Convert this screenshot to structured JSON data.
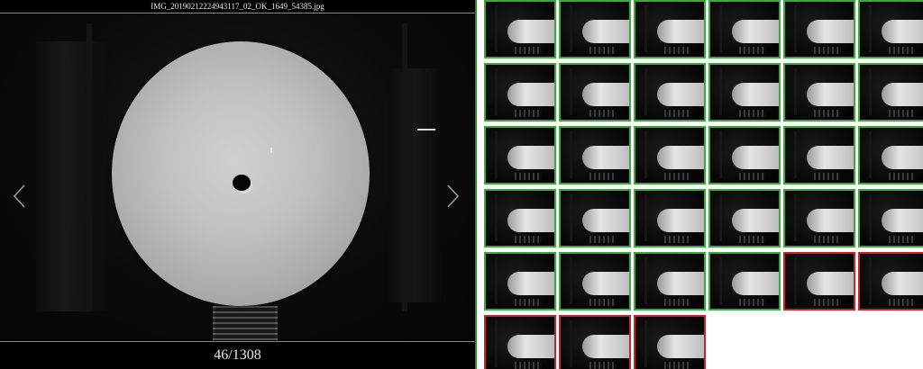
{
  "viewer": {
    "filename": "IMG_20190212224943117_02_OK_1649_54385.jpg",
    "counter": "46/1308"
  },
  "colors": {
    "ok_border": "#3aa83a",
    "ng_border": "#c8232c",
    "viewer_bg": "#000000"
  },
  "icons": {
    "prev": "chevron-left-icon",
    "next": "chevron-right-icon"
  },
  "thumbnails": [
    {
      "status": "ok"
    },
    {
      "status": "ok"
    },
    {
      "status": "ok"
    },
    {
      "status": "ok"
    },
    {
      "status": "ok"
    },
    {
      "status": "ok"
    },
    {
      "status": "ok"
    },
    {
      "status": "ok"
    },
    {
      "status": "ok"
    },
    {
      "status": "ok"
    },
    {
      "status": "ok"
    },
    {
      "status": "ok"
    },
    {
      "status": "ok"
    },
    {
      "status": "ok"
    },
    {
      "status": "ok"
    },
    {
      "status": "ok"
    },
    {
      "status": "ok"
    },
    {
      "status": "ok"
    },
    {
      "status": "ok"
    },
    {
      "status": "ok"
    },
    {
      "status": "ok"
    },
    {
      "status": "ok"
    },
    {
      "status": "ok"
    },
    {
      "status": "ok"
    },
    {
      "status": "ok"
    },
    {
      "status": "ok"
    },
    {
      "status": "ok"
    },
    {
      "status": "ok"
    },
    {
      "status": "ng"
    },
    {
      "status": "ng"
    },
    {
      "status": "ng"
    },
    {
      "status": "ng"
    },
    {
      "status": "ng"
    }
  ]
}
